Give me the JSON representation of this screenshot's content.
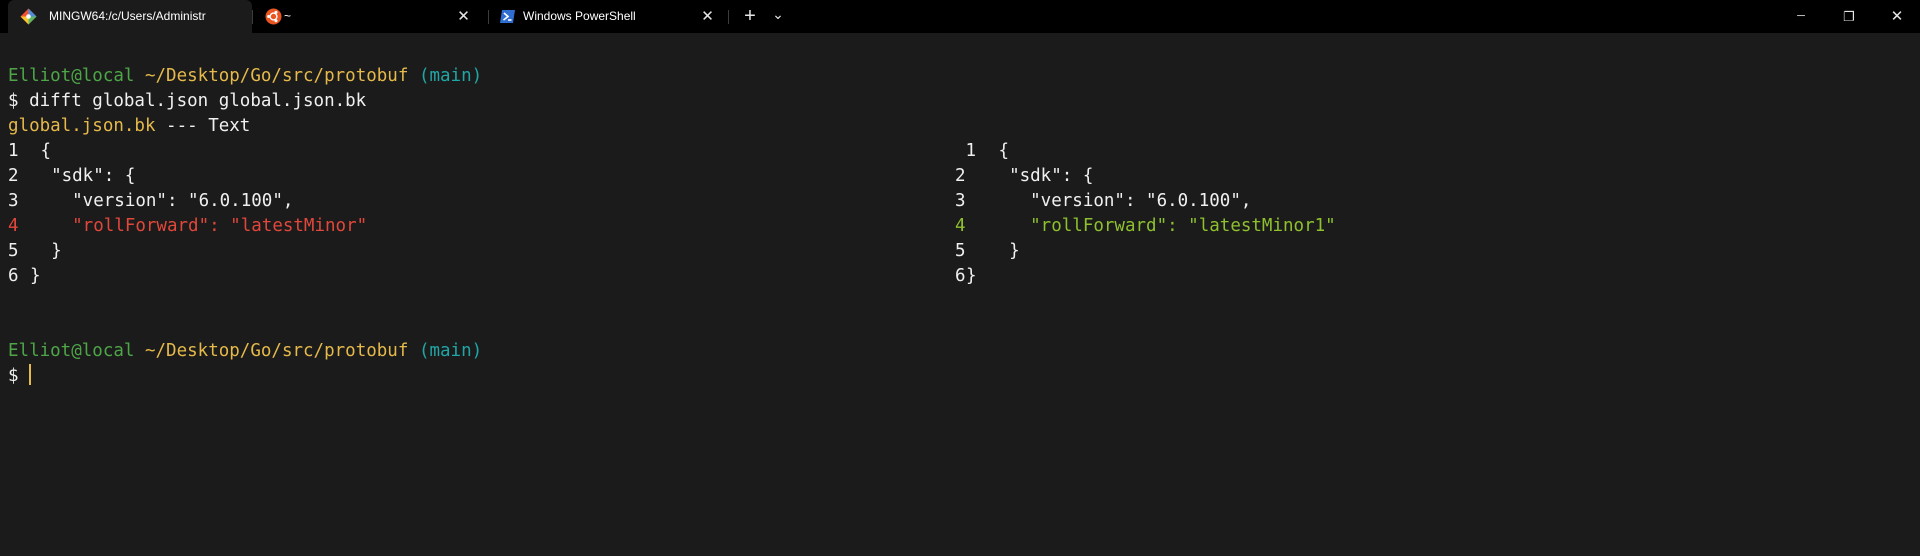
{
  "tabs": [
    {
      "title": "MINGW64:/c/Users/Administr",
      "icon": "git-bash-icon",
      "active": true
    },
    {
      "title": "~",
      "icon": "ubuntu-icon",
      "active": false
    },
    {
      "title": "Windows PowerShell",
      "icon": "powershell-icon",
      "active": false
    }
  ],
  "titlebar": {
    "new_tab": "+",
    "dropdown": "⌄",
    "minimize": "─",
    "maximize": "❐",
    "close": "✕"
  },
  "colors": {
    "user": "#4ea648",
    "path": "#e5b94a",
    "branch": "#21a6a6",
    "removed": "#e2473b",
    "added": "#8ec12d"
  },
  "prompt1": {
    "user": "Elliot@local",
    "path": "~/Desktop/Go/src/protobuf",
    "branch": "(main)"
  },
  "command": "$ difft global.json global.json.bk",
  "diff_header": {
    "file": "global.json.bk",
    "sep": " --- Text"
  },
  "left": [
    {
      "num": "1",
      "text": " {"
    },
    {
      "num": "2",
      "text": "  \"sdk\": {"
    },
    {
      "num": "3",
      "text": "    \"version\": \"6.0.100\","
    },
    {
      "num": "4",
      "text": "    \"rollForward\": \"latestMinor\""
    },
    {
      "num": "5",
      "text": "  }"
    },
    {
      "num": "6",
      "text": "}"
    }
  ],
  "right": [
    {
      "num": " 1",
      "text": " {"
    },
    {
      "num": "2",
      "text": "  \"sdk\": {"
    },
    {
      "num": "3",
      "text": "    \"version\": \"6.0.100\","
    },
    {
      "num": "4",
      "text": "    \"rollForward\": \"latestMinor1\""
    },
    {
      "num": "5",
      "text": "  }"
    },
    {
      "num": "6",
      "text": "}"
    }
  ],
  "prompt2": {
    "user": "Elliot@local",
    "path": "~/Desktop/Go/src/protobuf",
    "branch": "(main)",
    "input": "$ "
  }
}
